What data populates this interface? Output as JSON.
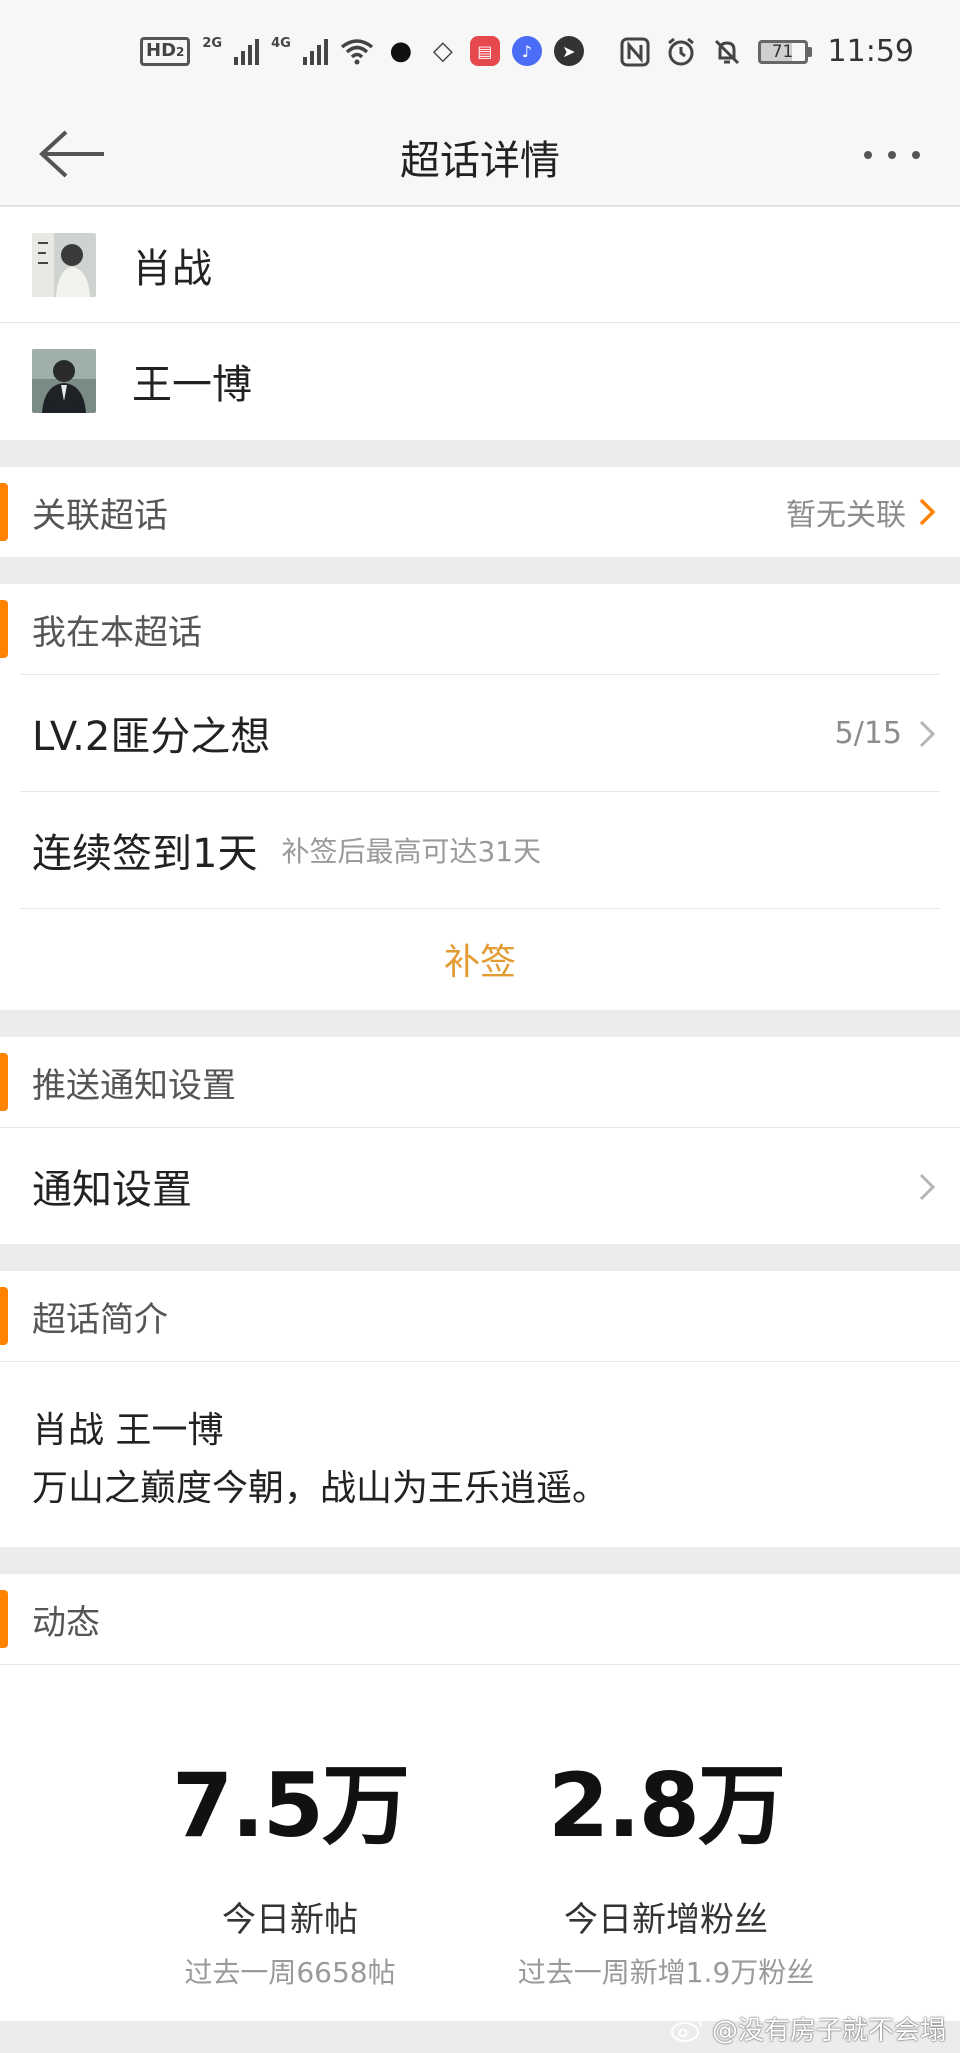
{
  "status_bar": {
    "hd_label": "HD",
    "hd_sub": "2",
    "net_2g": "2G",
    "net_4g": "4G",
    "time": "11:59",
    "battery": "71",
    "apps": [
      {
        "name": "qq-icon",
        "color": "#111111"
      },
      {
        "name": "alipay-icon",
        "color": "#1677ff"
      },
      {
        "name": "reader-app-icon",
        "color": "#e5484d"
      },
      {
        "name": "music-app-icon",
        "color": "#4a6cf7"
      },
      {
        "name": "browser-app-icon",
        "color": "#333333"
      }
    ]
  },
  "nav": {
    "title": "超话详情"
  },
  "persons": [
    {
      "name": "肖战"
    },
    {
      "name": "王一博"
    }
  ],
  "related": {
    "title": "关联超话",
    "value": "暂无关联"
  },
  "my_status": {
    "title": "我在本超话",
    "level": "LV.2匪分之想",
    "level_progress": "5/15",
    "checkin": "连续签到1天",
    "checkin_hint": "补签后最高可达31天",
    "resign_label": "补签"
  },
  "push": {
    "title": "推送通知设置",
    "item": "通知设置"
  },
  "intro": {
    "title": "超话简介",
    "line1": "肖战 王一博",
    "line2": "万山之巅度今朝，战山为王乐逍遥。"
  },
  "activity": {
    "title": "动态",
    "posts_value": "7.5万",
    "posts_label": "今日新帖",
    "posts_week": "过去一周6658帖",
    "fans_value": "2.8万",
    "fans_label": "今日新增粉丝",
    "fans_week": "过去一周新增1.9万粉丝"
  },
  "watermark": "@没有房子就不会塌",
  "colors": {
    "accent": "#ff8200",
    "resign": "#e39b34"
  }
}
